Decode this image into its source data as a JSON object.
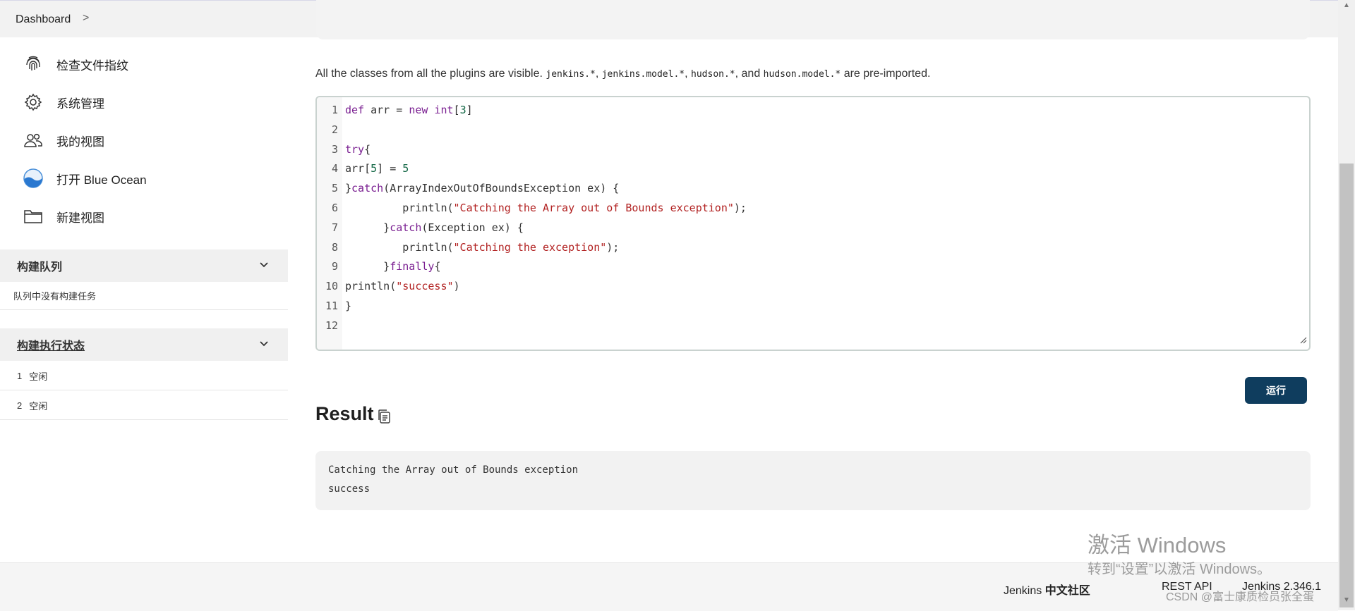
{
  "breadcrumb": {
    "dashboard": "Dashboard",
    "separator": ">"
  },
  "sidebar": {
    "tasks": [
      {
        "label": "检查文件指纹",
        "icon": "fingerprint-icon"
      },
      {
        "label": "系统管理",
        "icon": "gear-icon"
      },
      {
        "label": "我的视图",
        "icon": "people-icon"
      },
      {
        "label": "打开 Blue Ocean",
        "icon": "blue-ocean-icon"
      },
      {
        "label": "新建视图",
        "icon": "folder-icon"
      }
    ],
    "build_queue": {
      "title": "构建队列",
      "empty_message": "队列中没有构建任务"
    },
    "executor_status": {
      "title": "构建执行状态",
      "executors": [
        {
          "number": "1",
          "status": "空闲"
        },
        {
          "number": "2",
          "status": "空闲"
        }
      ]
    }
  },
  "main": {
    "description": {
      "prefix": "All the classes from all the plugins are visible.",
      "pkg1": "jenkins.*",
      "pkg2": "jenkins.model.*",
      "pkg3": "hudson.*",
      "pkg4": "hudson.model.*",
      "suffix": "are pre-imported."
    },
    "code_lines": [
      "def arr = new int[3]",
      "",
      "try{",
      "arr[5] = 5",
      "}catch(ArrayIndexOutOfBoundsException ex) {",
      "         println(\"Catching the Array out of Bounds exception\");",
      "      }catch(Exception ex) {",
      "         println(\"Catching the exception\");",
      "      }finally{",
      "println(\"success\")",
      "}",
      ""
    ],
    "line_numbers": [
      "1",
      "2",
      "3",
      "4",
      "5",
      "6",
      "7",
      "8",
      "9",
      "10",
      "11",
      "12"
    ],
    "run_button": "运行",
    "result_title": "Result",
    "result_lines": [
      "Catching the Array out of Bounds exception",
      "success"
    ]
  },
  "footer": {
    "community_prefix": "Jenkins",
    "community_suffix": "中文社区",
    "rest_api": "REST API",
    "version": "Jenkins 2.346.1"
  },
  "overlay": {
    "watermark_title": "激活 Windows",
    "watermark_sub": "转到“设置”以激活 Windows。",
    "csdn": "CSDN @富士康质检员张全蛋"
  },
  "colors": {
    "run_button": "#0f3d5e",
    "keyword": "#7a1f91",
    "string": "#b22222",
    "number": "#116644",
    "panel_bg": "#f0f0f0"
  }
}
